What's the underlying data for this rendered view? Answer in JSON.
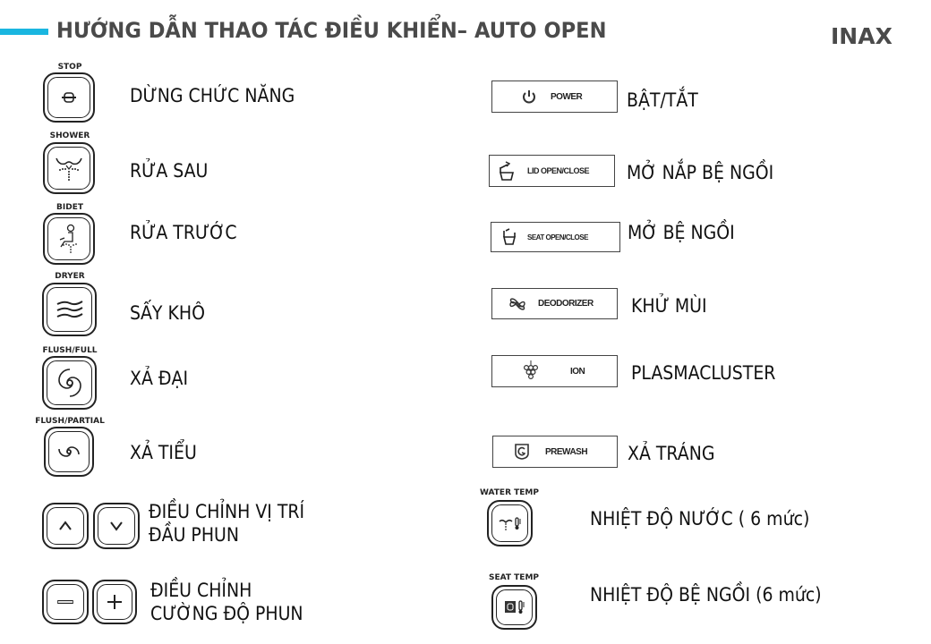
{
  "header": {
    "title": "HƯỚNG DẪN THAO TÁC ĐIỀU KHIỂN– AUTO OPEN",
    "brand": "INAX",
    "accent_color": "#1ab6e0"
  },
  "left_buttons": [
    {
      "caption": "STOP",
      "icon": "stop-icon",
      "description": "DỪNG CHỨC NĂNG"
    },
    {
      "caption": "SHOWER",
      "icon": "shower-icon",
      "description": "RỬA SAU"
    },
    {
      "caption": "BIDET",
      "icon": "bidet-icon",
      "description": "RỬA TRƯỚC"
    },
    {
      "caption": "DRYER",
      "icon": "dryer-icon",
      "description": "SẤY KHÔ"
    },
    {
      "caption": "FLUSH/FULL",
      "icon": "flush-full-icon",
      "description": "XẢ ĐẠI"
    },
    {
      "caption": "FLUSH/PARTIAL",
      "icon": "flush-partial-icon",
      "description": "XẢ TIỂU"
    }
  ],
  "position_control": {
    "icons": [
      "chevron-up-icon",
      "chevron-down-icon"
    ],
    "description_line1": "ĐIỀU CHỈNH VỊ TRÍ",
    "description_line2": "ĐẦU PHUN"
  },
  "pressure_control": {
    "icons": [
      "minus-icon",
      "plus-icon"
    ],
    "description_line1": "ĐIỀU CHỈNH",
    "description_line2": "CƯỜNG ĐỘ PHUN"
  },
  "right_buttons": [
    {
      "label": "POWER",
      "icon": "power-icon",
      "description": "BẬT/TẮT"
    },
    {
      "label": "LID OPEN/CLOSE",
      "icon": "lid-icon",
      "description": "MỞ NẮP BỆ NGỒI"
    },
    {
      "label": "SEAT OPEN/CLOSE",
      "icon": "seat-icon",
      "description": "MỞ BỆ NGỒI"
    },
    {
      "label": "DEODORIZER",
      "icon": "fan-icon",
      "description": "KHỬ MÙI"
    },
    {
      "label": "ION",
      "icon": "ion-cluster-icon",
      "description": "PLASMACLUSTER"
    },
    {
      "label": "PREWASH",
      "icon": "prewash-icon",
      "description": "XẢ TRÁNG"
    }
  ],
  "temp_buttons": [
    {
      "caption": "WATER TEMP",
      "icon": "water-temp-icon",
      "description": "NHIỆT ĐỘ NƯỚC ( 6 mức)"
    },
    {
      "caption": "SEAT TEMP",
      "icon": "seat-temp-icon",
      "description": "NHIỆT ĐỘ BỆ NGỒI (6 mức)"
    }
  ]
}
